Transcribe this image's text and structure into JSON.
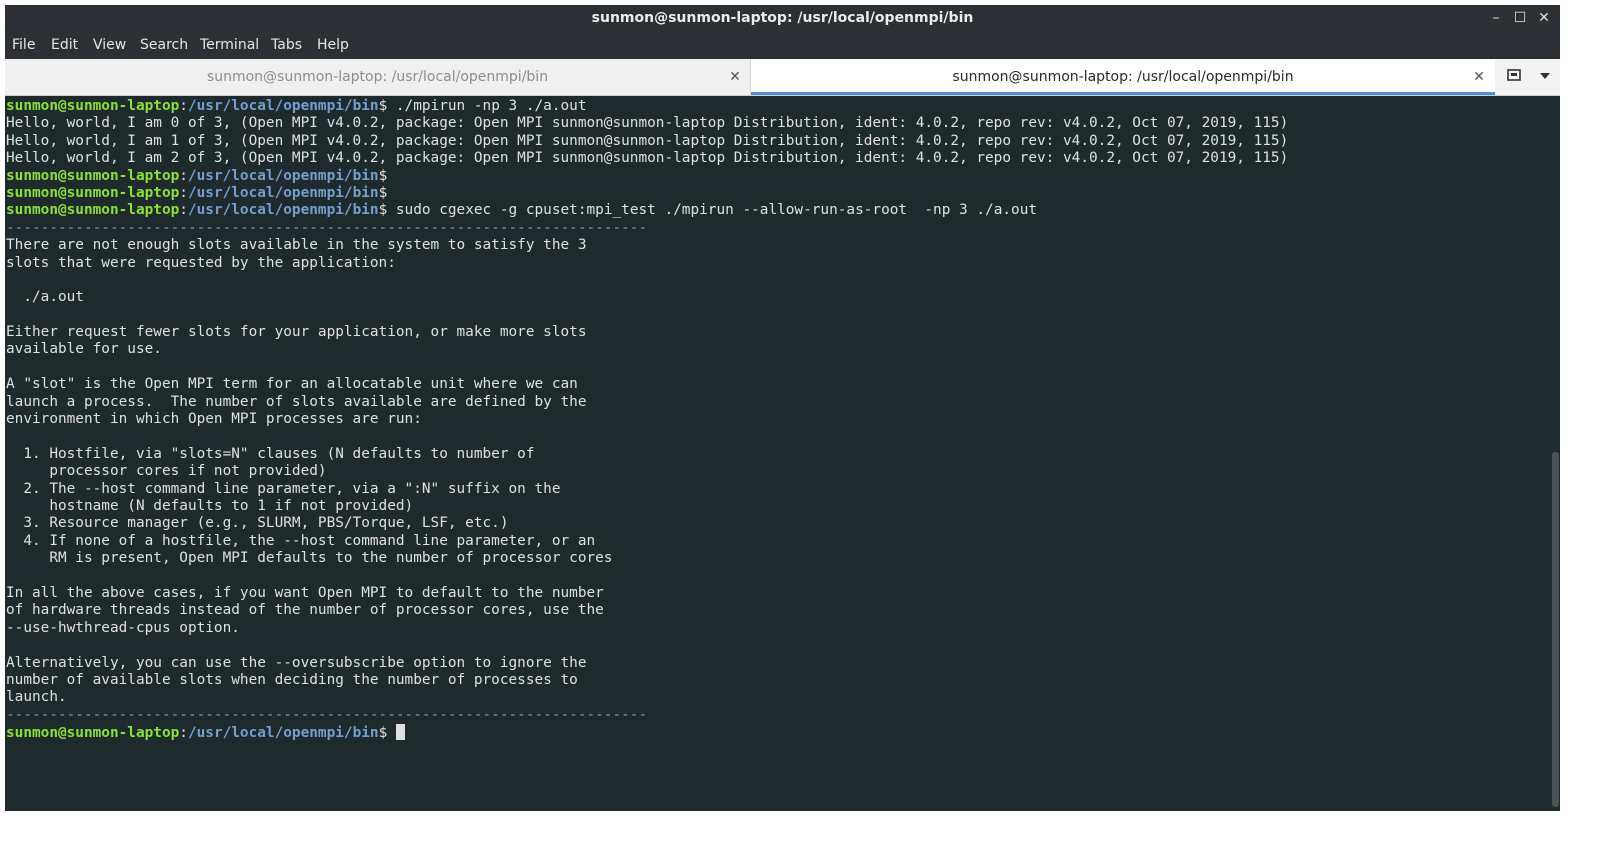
{
  "window": {
    "title": "sunmon@sunmon-laptop: /usr/local/openmpi/bin"
  },
  "controls": {
    "minimize": "–",
    "maximize": "☐",
    "close": "✕"
  },
  "menu": [
    "File",
    "Edit",
    "View",
    "Search",
    "Terminal",
    "Tabs",
    "Help"
  ],
  "tabs": [
    {
      "label": "sunmon@sunmon-laptop: /usr/local/openmpi/bin",
      "active": false
    },
    {
      "label": "sunmon@sunmon-laptop: /usr/local/openmpi/bin",
      "active": true
    }
  ],
  "icons": {
    "tab_close": "close-icon",
    "new_tab": "new-tab-icon",
    "tab_menu": "chevron-down-icon"
  },
  "prompt": {
    "user": "sunmon@sunmon-laptop",
    "sep": ":",
    "path": "/usr/local/openmpi/bin",
    "symbol": "$"
  },
  "colors": {
    "prompt_user": "#8ae234",
    "prompt_path": "#729fcf",
    "background": "#1f2a2d",
    "text": "#e0e0e0",
    "active_tab_accent": "#4c8fd1"
  },
  "terminal": {
    "lines": [
      {
        "prompt": true,
        "cmd": " ./mpirun -np 3 ./a.out"
      },
      {
        "text": "Hello, world, I am 0 of 3, (Open MPI v4.0.2, package: Open MPI sunmon@sunmon-laptop Distribution, ident: 4.0.2, repo rev: v4.0.2, Oct 07, 2019, 115)"
      },
      {
        "text": "Hello, world, I am 1 of 3, (Open MPI v4.0.2, package: Open MPI sunmon@sunmon-laptop Distribution, ident: 4.0.2, repo rev: v4.0.2, Oct 07, 2019, 115)"
      },
      {
        "text": "Hello, world, I am 2 of 3, (Open MPI v4.0.2, package: Open MPI sunmon@sunmon-laptop Distribution, ident: 4.0.2, repo rev: v4.0.2, Oct 07, 2019, 115)"
      },
      {
        "prompt": true,
        "cmd": ""
      },
      {
        "prompt": true,
        "cmd": ""
      },
      {
        "prompt": true,
        "cmd": " sudo cgexec -g cpuset:mpi_test ./mpirun --allow-run-as-root  -np 3 ./a.out"
      },
      {
        "text": "--------------------------------------------------------------------------",
        "dash": true
      },
      {
        "text": "There are not enough slots available in the system to satisfy the 3"
      },
      {
        "text": "slots that were requested by the application:"
      },
      {
        "text": ""
      },
      {
        "text": "  ./a.out"
      },
      {
        "text": ""
      },
      {
        "text": "Either request fewer slots for your application, or make more slots"
      },
      {
        "text": "available for use."
      },
      {
        "text": ""
      },
      {
        "text": "A \"slot\" is the Open MPI term for an allocatable unit where we can"
      },
      {
        "text": "launch a process.  The number of slots available are defined by the"
      },
      {
        "text": "environment in which Open MPI processes are run:"
      },
      {
        "text": ""
      },
      {
        "text": "  1. Hostfile, via \"slots=N\" clauses (N defaults to number of"
      },
      {
        "text": "     processor cores if not provided)"
      },
      {
        "text": "  2. The --host command line parameter, via a \":N\" suffix on the"
      },
      {
        "text": "     hostname (N defaults to 1 if not provided)"
      },
      {
        "text": "  3. Resource manager (e.g., SLURM, PBS/Torque, LSF, etc.)"
      },
      {
        "text": "  4. If none of a hostfile, the --host command line parameter, or an"
      },
      {
        "text": "     RM is present, Open MPI defaults to the number of processor cores"
      },
      {
        "text": ""
      },
      {
        "text": "In all the above cases, if you want Open MPI to default to the number"
      },
      {
        "text": "of hardware threads instead of the number of processor cores, use the"
      },
      {
        "text": "--use-hwthread-cpus option."
      },
      {
        "text": ""
      },
      {
        "text": "Alternatively, you can use the --oversubscribe option to ignore the"
      },
      {
        "text": "number of available slots when deciding the number of processes to"
      },
      {
        "text": "launch."
      },
      {
        "text": "--------------------------------------------------------------------------",
        "dash": true
      },
      {
        "prompt": true,
        "cmd": " ",
        "cursor": true
      }
    ]
  }
}
